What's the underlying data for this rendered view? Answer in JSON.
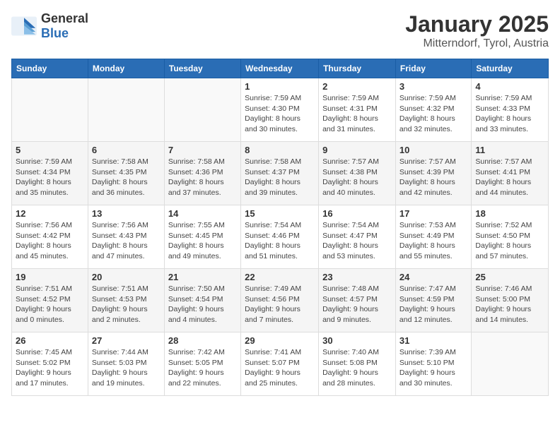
{
  "header": {
    "logo_general": "General",
    "logo_blue": "Blue",
    "month_year": "January 2025",
    "location": "Mitterndorf, Tyrol, Austria"
  },
  "weekdays": [
    "Sunday",
    "Monday",
    "Tuesday",
    "Wednesday",
    "Thursday",
    "Friday",
    "Saturday"
  ],
  "weeks": [
    [
      {
        "day": "",
        "info": ""
      },
      {
        "day": "",
        "info": ""
      },
      {
        "day": "",
        "info": ""
      },
      {
        "day": "1",
        "info": "Sunrise: 7:59 AM\nSunset: 4:30 PM\nDaylight: 8 hours\nand 30 minutes."
      },
      {
        "day": "2",
        "info": "Sunrise: 7:59 AM\nSunset: 4:31 PM\nDaylight: 8 hours\nand 31 minutes."
      },
      {
        "day": "3",
        "info": "Sunrise: 7:59 AM\nSunset: 4:32 PM\nDaylight: 8 hours\nand 32 minutes."
      },
      {
        "day": "4",
        "info": "Sunrise: 7:59 AM\nSunset: 4:33 PM\nDaylight: 8 hours\nand 33 minutes."
      }
    ],
    [
      {
        "day": "5",
        "info": "Sunrise: 7:59 AM\nSunset: 4:34 PM\nDaylight: 8 hours\nand 35 minutes."
      },
      {
        "day": "6",
        "info": "Sunrise: 7:58 AM\nSunset: 4:35 PM\nDaylight: 8 hours\nand 36 minutes."
      },
      {
        "day": "7",
        "info": "Sunrise: 7:58 AM\nSunset: 4:36 PM\nDaylight: 8 hours\nand 37 minutes."
      },
      {
        "day": "8",
        "info": "Sunrise: 7:58 AM\nSunset: 4:37 PM\nDaylight: 8 hours\nand 39 minutes."
      },
      {
        "day": "9",
        "info": "Sunrise: 7:57 AM\nSunset: 4:38 PM\nDaylight: 8 hours\nand 40 minutes."
      },
      {
        "day": "10",
        "info": "Sunrise: 7:57 AM\nSunset: 4:39 PM\nDaylight: 8 hours\nand 42 minutes."
      },
      {
        "day": "11",
        "info": "Sunrise: 7:57 AM\nSunset: 4:41 PM\nDaylight: 8 hours\nand 44 minutes."
      }
    ],
    [
      {
        "day": "12",
        "info": "Sunrise: 7:56 AM\nSunset: 4:42 PM\nDaylight: 8 hours\nand 45 minutes."
      },
      {
        "day": "13",
        "info": "Sunrise: 7:56 AM\nSunset: 4:43 PM\nDaylight: 8 hours\nand 47 minutes."
      },
      {
        "day": "14",
        "info": "Sunrise: 7:55 AM\nSunset: 4:45 PM\nDaylight: 8 hours\nand 49 minutes."
      },
      {
        "day": "15",
        "info": "Sunrise: 7:54 AM\nSunset: 4:46 PM\nDaylight: 8 hours\nand 51 minutes."
      },
      {
        "day": "16",
        "info": "Sunrise: 7:54 AM\nSunset: 4:47 PM\nDaylight: 8 hours\nand 53 minutes."
      },
      {
        "day": "17",
        "info": "Sunrise: 7:53 AM\nSunset: 4:49 PM\nDaylight: 8 hours\nand 55 minutes."
      },
      {
        "day": "18",
        "info": "Sunrise: 7:52 AM\nSunset: 4:50 PM\nDaylight: 8 hours\nand 57 minutes."
      }
    ],
    [
      {
        "day": "19",
        "info": "Sunrise: 7:51 AM\nSunset: 4:52 PM\nDaylight: 9 hours\nand 0 minutes."
      },
      {
        "day": "20",
        "info": "Sunrise: 7:51 AM\nSunset: 4:53 PM\nDaylight: 9 hours\nand 2 minutes."
      },
      {
        "day": "21",
        "info": "Sunrise: 7:50 AM\nSunset: 4:54 PM\nDaylight: 9 hours\nand 4 minutes."
      },
      {
        "day": "22",
        "info": "Sunrise: 7:49 AM\nSunset: 4:56 PM\nDaylight: 9 hours\nand 7 minutes."
      },
      {
        "day": "23",
        "info": "Sunrise: 7:48 AM\nSunset: 4:57 PM\nDaylight: 9 hours\nand 9 minutes."
      },
      {
        "day": "24",
        "info": "Sunrise: 7:47 AM\nSunset: 4:59 PM\nDaylight: 9 hours\nand 12 minutes."
      },
      {
        "day": "25",
        "info": "Sunrise: 7:46 AM\nSunset: 5:00 PM\nDaylight: 9 hours\nand 14 minutes."
      }
    ],
    [
      {
        "day": "26",
        "info": "Sunrise: 7:45 AM\nSunset: 5:02 PM\nDaylight: 9 hours\nand 17 minutes."
      },
      {
        "day": "27",
        "info": "Sunrise: 7:44 AM\nSunset: 5:03 PM\nDaylight: 9 hours\nand 19 minutes."
      },
      {
        "day": "28",
        "info": "Sunrise: 7:42 AM\nSunset: 5:05 PM\nDaylight: 9 hours\nand 22 minutes."
      },
      {
        "day": "29",
        "info": "Sunrise: 7:41 AM\nSunset: 5:07 PM\nDaylight: 9 hours\nand 25 minutes."
      },
      {
        "day": "30",
        "info": "Sunrise: 7:40 AM\nSunset: 5:08 PM\nDaylight: 9 hours\nand 28 minutes."
      },
      {
        "day": "31",
        "info": "Sunrise: 7:39 AM\nSunset: 5:10 PM\nDaylight: 9 hours\nand 30 minutes."
      },
      {
        "day": "",
        "info": ""
      }
    ]
  ]
}
